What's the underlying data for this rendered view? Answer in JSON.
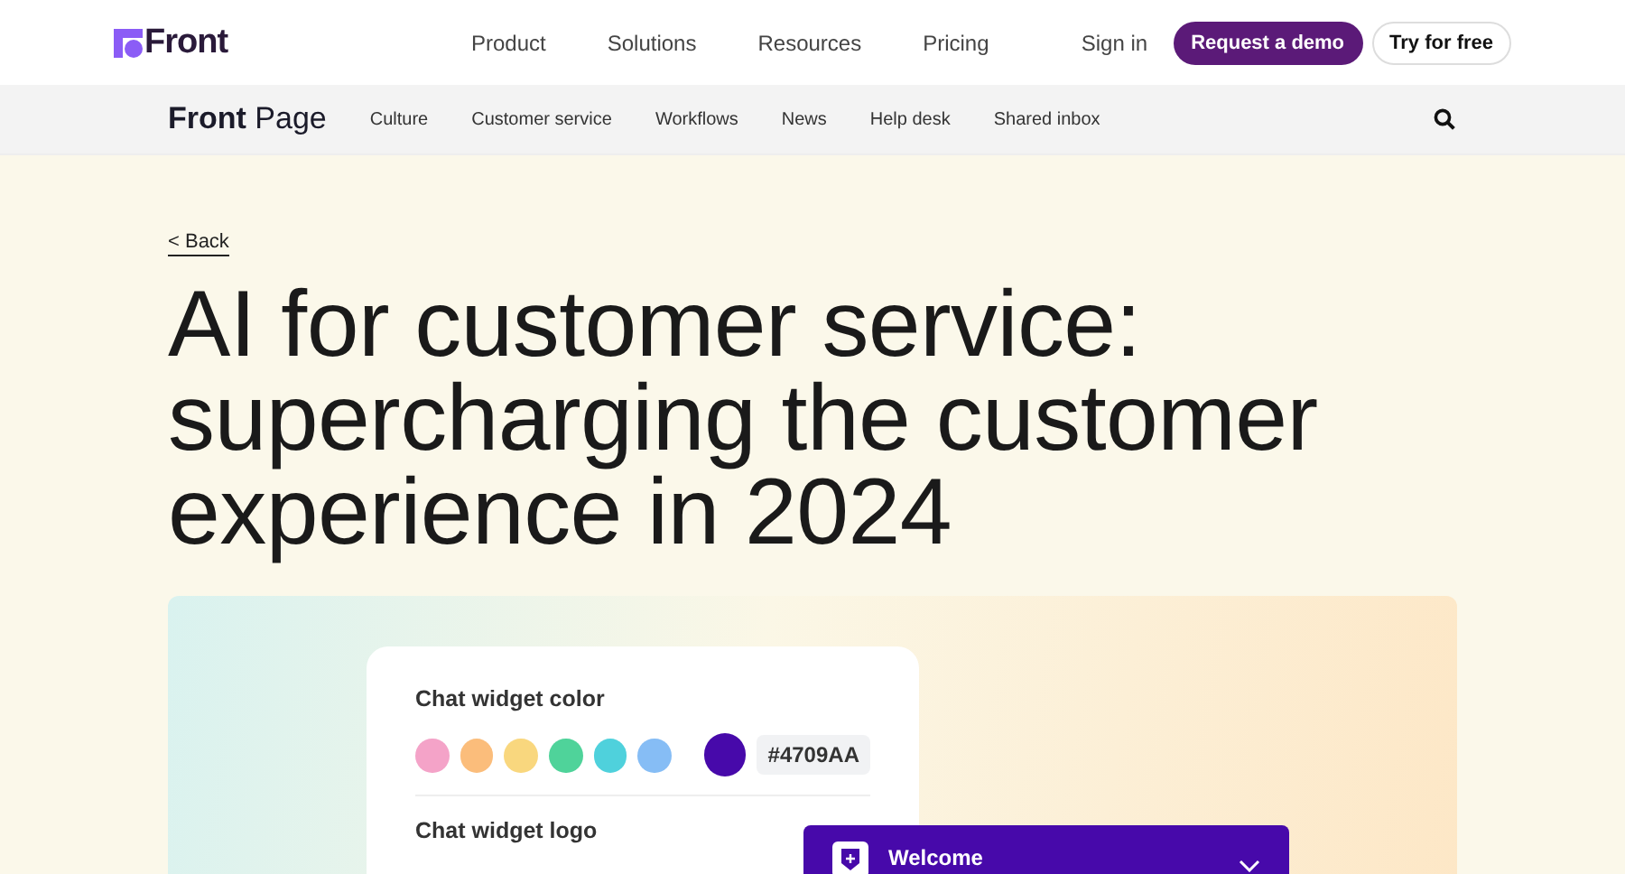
{
  "header": {
    "logo": "Front",
    "nav": [
      "Product",
      "Solutions",
      "Resources",
      "Pricing"
    ],
    "sign_in": "Sign in",
    "demo_button": "Request a demo",
    "trial_button": "Try for free"
  },
  "subnav": {
    "brand_bold": "Front",
    "brand_light": "Page",
    "items": [
      "Culture",
      "Customer service",
      "Workflows",
      "News",
      "Help desk",
      "Shared inbox"
    ]
  },
  "back_link": "< Back",
  "headline": "AI for customer service: supercharging the customer experience in 2024",
  "card": {
    "color_label": "Chat widget color",
    "swatches": [
      {
        "color": "#f4a3c8",
        "selected": false
      },
      {
        "color": "#fbbd7b",
        "selected": false
      },
      {
        "color": "#f9d77e",
        "selected": false
      },
      {
        "color": "#4fd39a",
        "selected": false
      },
      {
        "color": "#4fd1dc",
        "selected": false
      },
      {
        "color": "#86bdf5",
        "selected": false
      },
      {
        "color": "#4709aa",
        "selected": true
      }
    ],
    "hex_value": "#4709AA",
    "logo_label": "Chat widget logo"
  },
  "widget": {
    "title": "Welcome"
  }
}
